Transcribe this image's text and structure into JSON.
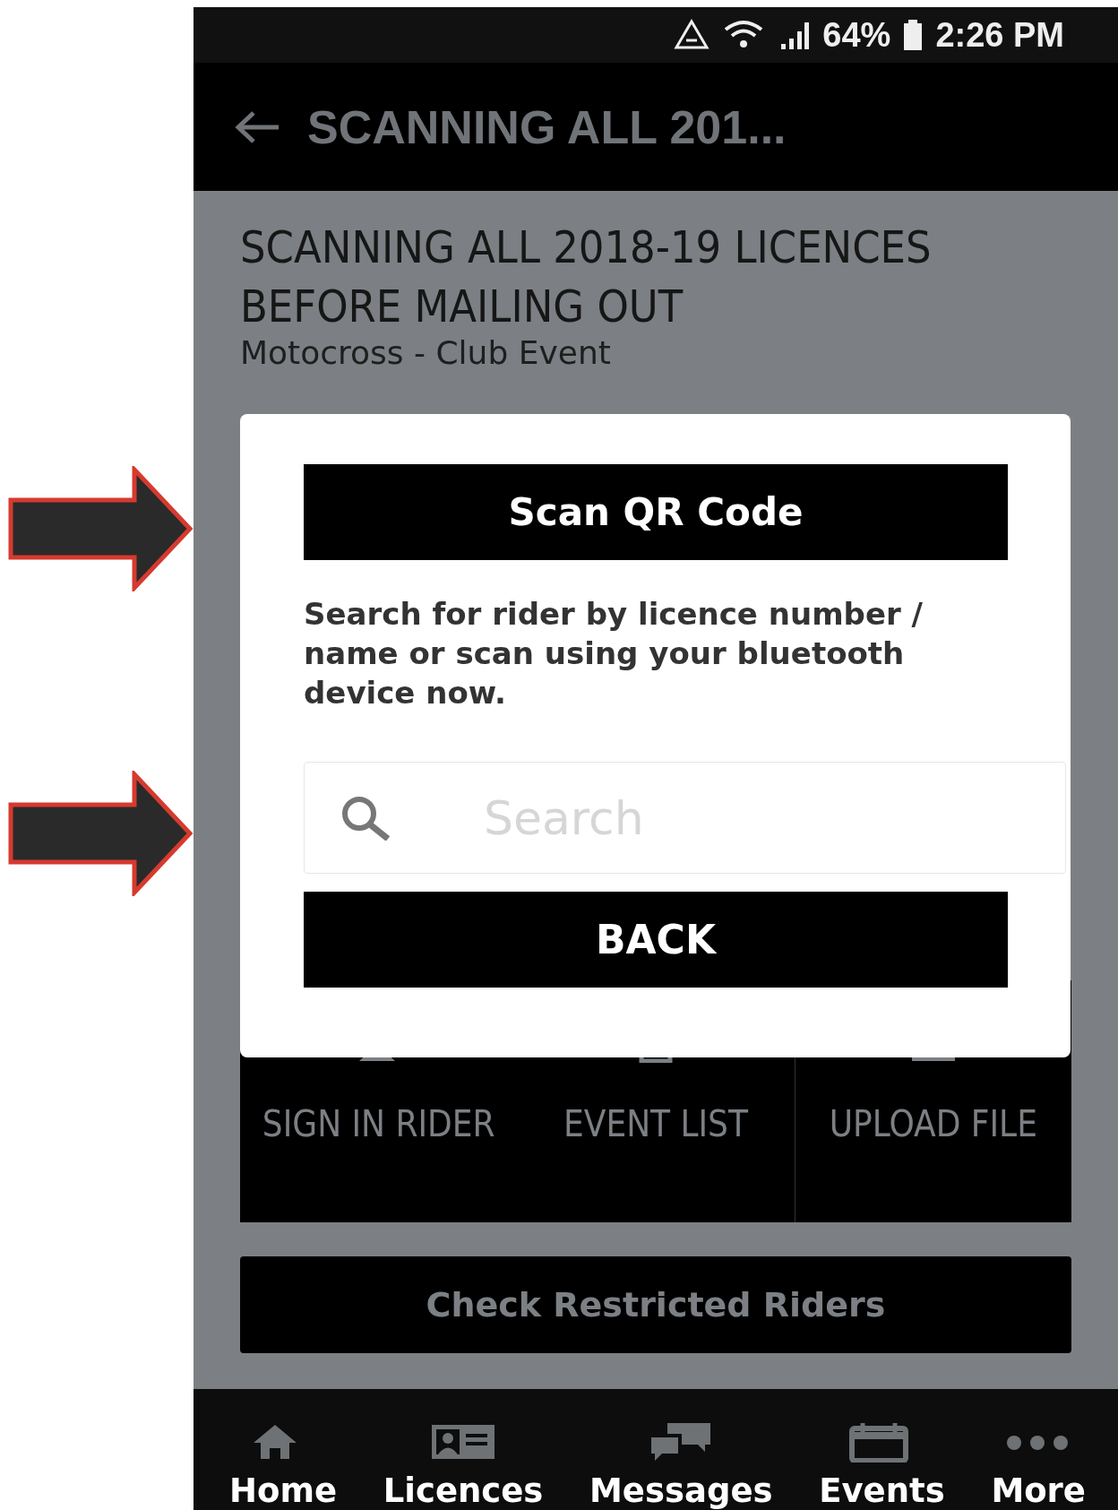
{
  "status_bar": {
    "battery": "64%",
    "time": "2:26 PM"
  },
  "app_bar": {
    "title": "SCANNING ALL 201..."
  },
  "event": {
    "title": "SCANNING ALL 2018-19 LICENCES BEFORE MAILING OUT",
    "subtitle": "Motocross - Club Event"
  },
  "actions": [
    {
      "kind": "sign-in",
      "label": "SIGN IN RIDER"
    },
    {
      "kind": "list",
      "label": "EVENT LIST"
    },
    {
      "kind": "upload",
      "label": "UPLOAD FILE"
    }
  ],
  "restricted_button": "Check Restricted Riders",
  "dialog": {
    "scan_button": "Scan QR Code",
    "instructions": "Search for rider by licence number / name or scan using your bluetooth device now.",
    "search": {
      "placeholder": "Search"
    },
    "back_button": "BACK"
  },
  "bottom_nav": [
    {
      "kind": "home",
      "label": "Home"
    },
    {
      "kind": "licence",
      "label": "Licences"
    },
    {
      "kind": "messages",
      "label": "Messages"
    },
    {
      "kind": "events",
      "label": "Events"
    },
    {
      "kind": "more",
      "label": "More"
    }
  ]
}
